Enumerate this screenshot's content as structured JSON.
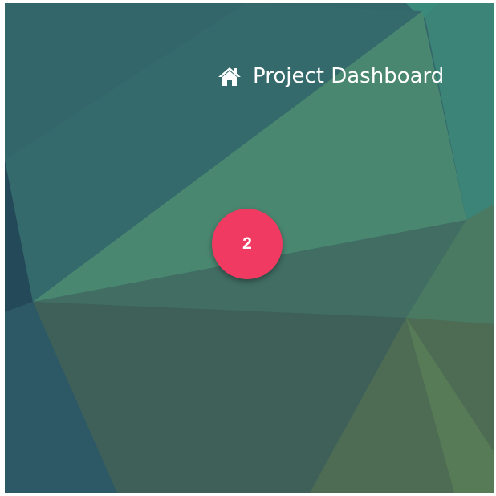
{
  "header": {
    "home_icon": "home-icon",
    "title": "Project Dashboard"
  },
  "badge": {
    "value": "2",
    "color": "#f03a62"
  },
  "background": {
    "style": "low-poly teal/green geometric pattern",
    "colors": [
      "#33676a",
      "#3e7a6e",
      "#4a8970",
      "#2c5462",
      "#435f55",
      "#516f55"
    ]
  }
}
